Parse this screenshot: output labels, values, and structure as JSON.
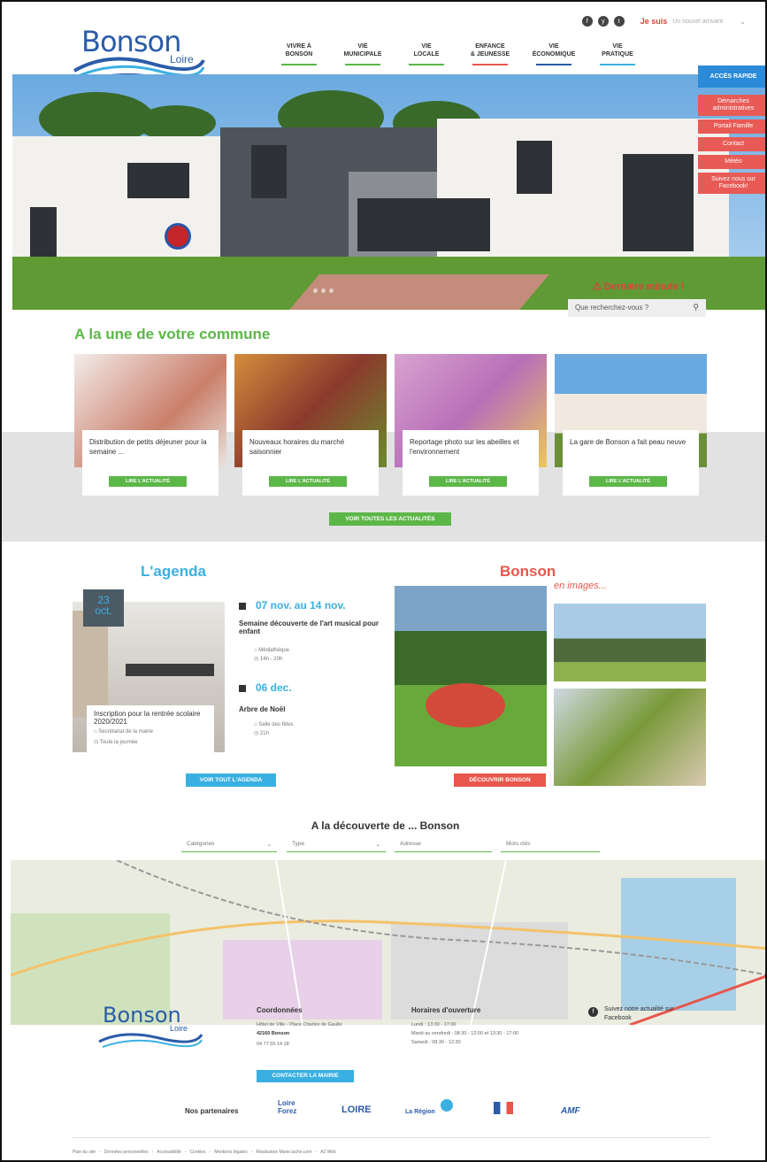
{
  "header": {
    "logo_title": "Bonson",
    "logo_sub": "Loire",
    "social": [
      "f",
      "y",
      "t"
    ],
    "jesuis_label": "Je suis",
    "jesuis_select": "Un nouvel arrivant",
    "nav": [
      {
        "line1": "VIVRE À",
        "line2": "BONSON",
        "color": "#5cb748"
      },
      {
        "line1": "VIE",
        "line2": "MUNICIPALE",
        "color": "#5cb748"
      },
      {
        "line1": "VIE",
        "line2": "LOCALE",
        "color": "#5cb748"
      },
      {
        "line1": "ENFANCE",
        "line2": "& JEUNESSE",
        "color": "#e8564c"
      },
      {
        "line1": "VIE",
        "line2": "ÉCONOMIQUE",
        "color": "#2b5ca8"
      },
      {
        "line1": "VIE",
        "line2": "PRATIQUE",
        "color": "#3ab0e2"
      }
    ]
  },
  "access": {
    "head": "ACCÈS RAPIDE",
    "items": [
      "Démarches administratives",
      "Portail Famille",
      "Contact",
      "Météo",
      "Suivez nous sur Facebook!"
    ]
  },
  "hero": {
    "derniere": "Dernière minute !",
    "search_placeholder": "Que recherchez-vous ?"
  },
  "une": {
    "title": "A la une de votre commune",
    "cards": [
      {
        "title": "Distribution de petits déjeuner pour la semaine ...",
        "button": "LIRE L'ACTUALITÉ"
      },
      {
        "title": "Nouveaux horaires du marché saisonnier",
        "button": "LIRE L'ACTUALITÉ"
      },
      {
        "title": "Reportage photo sur les abeilles et l'environnement",
        "button": "LIRE L'ACTUALITÉ"
      },
      {
        "title": "La gare de Bonson a fait peau neuve",
        "button": "LIRE L'ACTUALITÉ"
      }
    ],
    "voir_all": "VOIR TOUTES LES ACTUALITÉS"
  },
  "agenda": {
    "title": "L'agenda",
    "feature": {
      "day": "23",
      "month": "oct.",
      "title": "Inscription pour la rentrée scolaire 2020/2021",
      "place": "Secrétariat de la mairie",
      "time": "Toute la journée"
    },
    "events": [
      {
        "date": "07 nov. au 14 nov.",
        "title": "Semaine découverte de l'art musical pour enfant",
        "place": "Médiathèque",
        "time": "14h - 20h"
      },
      {
        "date": "06 dec.",
        "title": "Arbre de Noël",
        "place": "Salle des fêtes",
        "time": "21h"
      }
    ],
    "voir": "VOIR TOUT L'AGENDA"
  },
  "images": {
    "title": "Bonson",
    "subtitle": "en images...",
    "button": "DÉCOUVRIR BONSON"
  },
  "discovery": {
    "title": "A la découverte de ... Bonson",
    "filters": [
      "Catégories",
      "Type",
      "Adresse",
      "Mots clés"
    ]
  },
  "footer": {
    "coord_title": "Coordonnées",
    "address": "Hôtel de Ville - Place Charles de Gaulle",
    "city": "42160 Bonson",
    "phone": "04 77 55 14 18",
    "contact_btn": "CONTACTER LA MAIRIE",
    "hours_title": "Horaires d'ouverture",
    "hours": [
      "Lundi : 13:30 - 17:00",
      "Mardi au vendredi : 08:30 - 12:00 et 13:30 - 17:00",
      "Samedi : 08:30 - 12:30"
    ],
    "facebook": "Suivez notre actualité sur Facebook",
    "partners_label": "Nos partenaires",
    "partners": [
      "Loire Forez",
      "LOIRE",
      "La Région",
      "RF",
      "AMF"
    ],
    "links": [
      "Plan du site",
      "-",
      "Données personnelles",
      "-",
      "Accessibilité",
      "-",
      "Cookies",
      "-",
      "Mentions légales",
      "-",
      "Réalisation Marie.tache.com",
      "-",
      "A2 Web"
    ]
  }
}
